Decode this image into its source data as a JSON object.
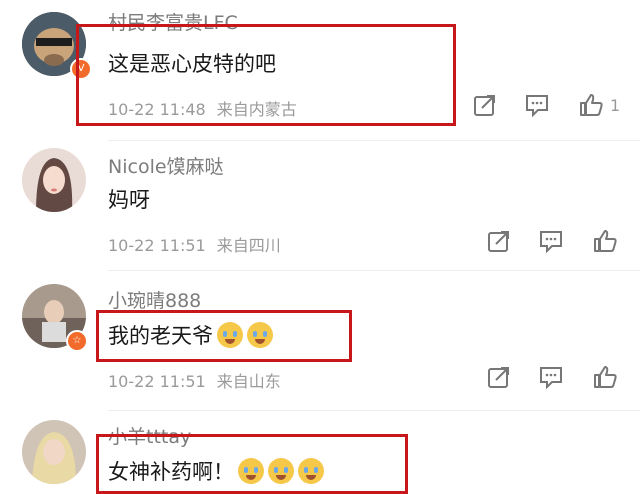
{
  "colors": {
    "accent_box": "#c8171b",
    "badge": "#f26b2a"
  },
  "comments": [
    {
      "username": "村民李富贵LFC",
      "text": "这是恶心皮特的吧",
      "date": "10-22 11:48",
      "location": "来自内蒙古",
      "like_count": "1",
      "has_badge": true
    },
    {
      "username": "Nicole馍麻哒",
      "text": "妈呀",
      "date": "10-22 11:51",
      "location": "来自四川",
      "has_badge": false
    },
    {
      "username": "小琬晴888",
      "text": "我的老天爷",
      "date": "10-22 11:51",
      "location": "来自山东",
      "emoji": [
        "grinning-tears-emoji",
        "crying-emoji"
      ],
      "has_badge": true
    },
    {
      "username": "小羊tttay",
      "text": "女神补药啊！",
      "emoji": [
        "crying-emoji",
        "crying-emoji",
        "crying-emoji"
      ],
      "has_badge": false
    }
  ],
  "icons": {
    "share": "share-icon",
    "comment": "comment-icon",
    "like": "thumbs-up-icon"
  }
}
